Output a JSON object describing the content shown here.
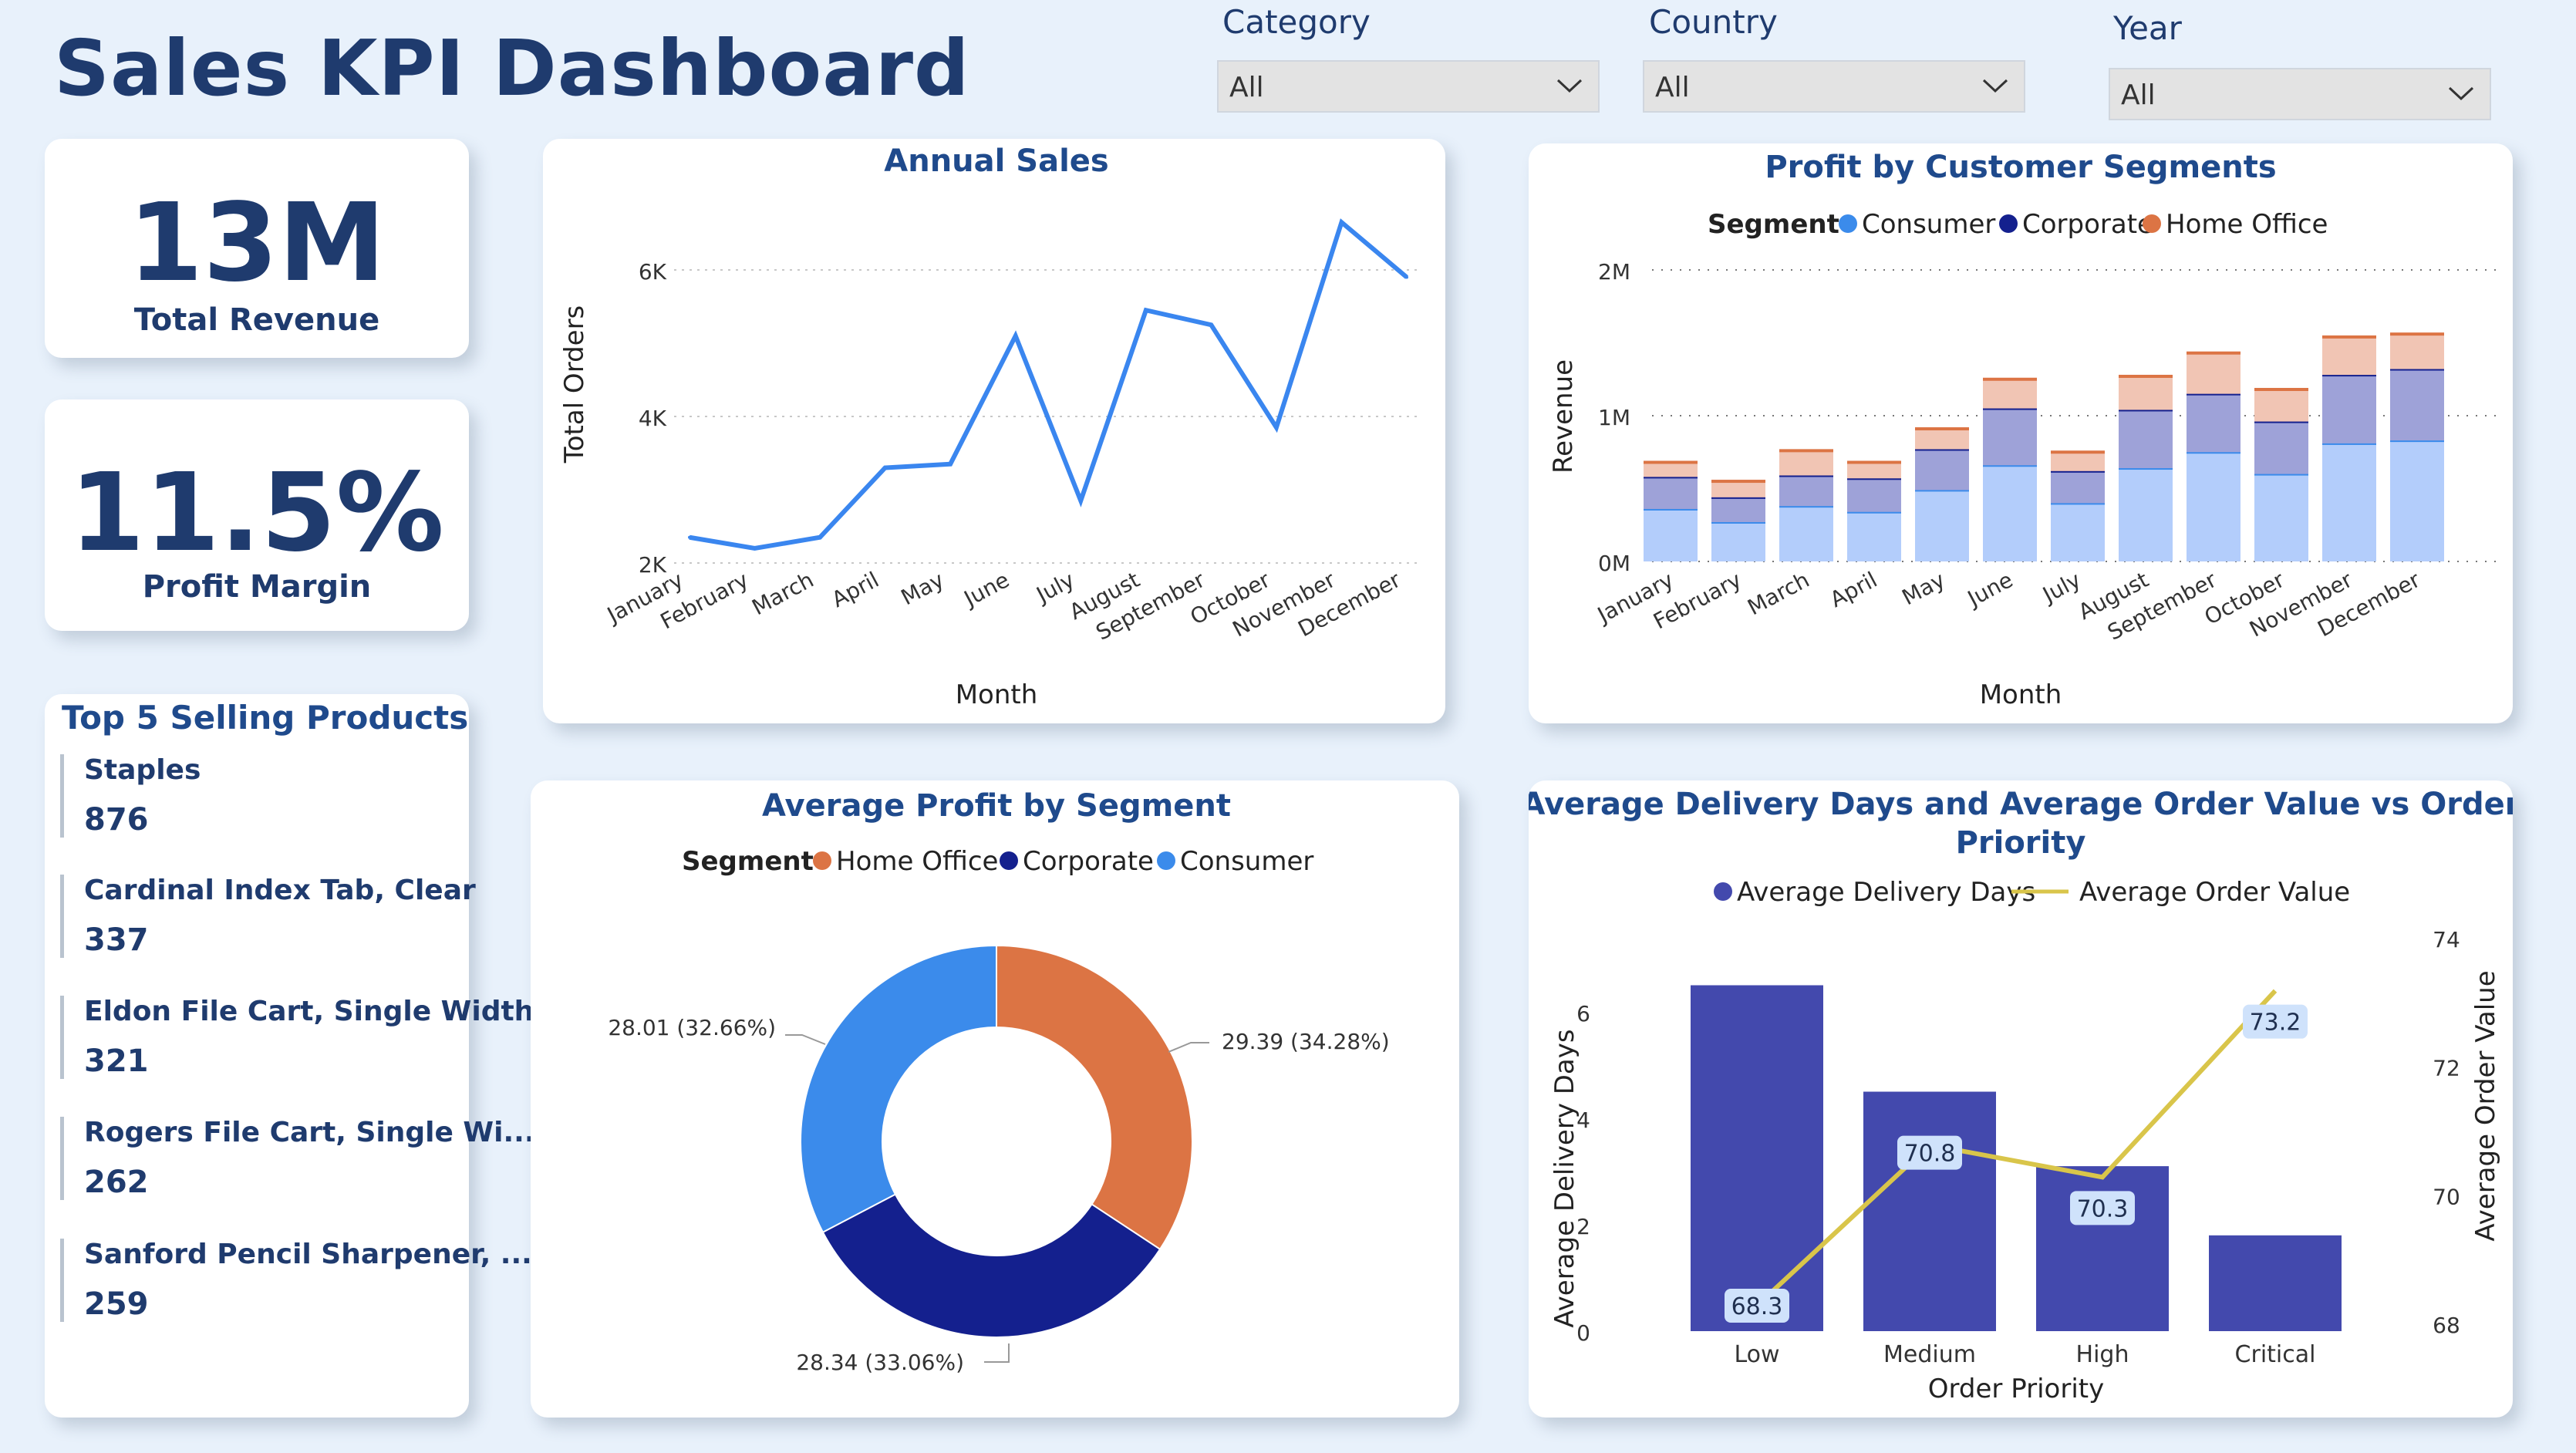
{
  "page_title": "Sales KPI Dashboard",
  "filters": [
    {
      "label": "Category",
      "value": "All"
    },
    {
      "label": "Country",
      "value": "All"
    },
    {
      "label": "Year",
      "value": "All"
    }
  ],
  "kpis": {
    "revenue": {
      "value": "13M",
      "label": "Total Revenue"
    },
    "margin": {
      "value": "11.5%",
      "label": "Profit Margin"
    }
  },
  "top_products": {
    "title": "Top 5 Selling Products",
    "items": [
      {
        "name": "Staples",
        "value": "876"
      },
      {
        "name": "Cardinal Index Tab, Clear",
        "value": "337"
      },
      {
        "name": "Eldon File Cart, Single Width",
        "value": "321"
      },
      {
        "name": "Rogers File Cart, Single Wi...",
        "value": "262"
      },
      {
        "name": "Sanford Pencil Sharpener, ...",
        "value": "259"
      }
    ]
  },
  "colors": {
    "line": "#3a86ef",
    "consumer": "#3b8beb",
    "corporate": "#14208e",
    "home_office": "#dc7444",
    "bar_purple": "#4349ad",
    "line_gold": "#d9c54a"
  },
  "chart_data": [
    {
      "id": "annual_sales",
      "type": "line",
      "title": "Annual Sales",
      "xlabel": "Month",
      "ylabel": "Total Orders",
      "categories": [
        "January",
        "February",
        "March",
        "April",
        "May",
        "June",
        "July",
        "August",
        "September",
        "October",
        "November",
        "December"
      ],
      "values": [
        2350,
        2200,
        2350,
        3300,
        3350,
        5100,
        2850,
        5450,
        5250,
        3850,
        6650,
        5900
      ],
      "y_ticks": [
        "2K",
        "4K",
        "6K"
      ],
      "ylim": [
        2000,
        6600
      ],
      "grid": true
    },
    {
      "id": "profit_segments",
      "type": "bar",
      "stacked": true,
      "title": "Profit by Customer Segments",
      "xlabel": "Month",
      "ylabel": "Revenue",
      "legend_title": "Segment",
      "legend": [
        "Consumer",
        "Corporate",
        "Home Office"
      ],
      "categories": [
        "January",
        "February",
        "March",
        "April",
        "May",
        "June",
        "July",
        "August",
        "September",
        "October",
        "November",
        "December"
      ],
      "series": [
        {
          "name": "Consumer",
          "values": [
            0.36,
            0.27,
            0.38,
            0.34,
            0.49,
            0.66,
            0.4,
            0.64,
            0.75,
            0.6,
            0.81,
            0.83
          ]
        },
        {
          "name": "Corporate",
          "values": [
            0.22,
            0.17,
            0.21,
            0.23,
            0.28,
            0.39,
            0.22,
            0.4,
            0.4,
            0.36,
            0.47,
            0.49
          ]
        },
        {
          "name": "Home Office",
          "values": [
            0.1,
            0.11,
            0.17,
            0.11,
            0.14,
            0.2,
            0.13,
            0.23,
            0.28,
            0.22,
            0.26,
            0.24
          ]
        }
      ],
      "y_ticks": [
        "0M",
        "1M",
        "2M"
      ],
      "ylim": [
        0,
        2
      ],
      "grid": true
    },
    {
      "id": "avg_profit_segment",
      "type": "pie",
      "donut": true,
      "title": "Average Profit by Segment",
      "legend_title": "Segment",
      "legend": [
        "Home Office",
        "Corporate",
        "Consumer"
      ],
      "slices": [
        {
          "name": "Home Office",
          "value": 29.39,
          "label": "29.39 (34.28%)"
        },
        {
          "name": "Corporate",
          "value": 28.34,
          "label": "28.34 (33.06%)"
        },
        {
          "name": "Consumer",
          "value": 28.01,
          "label": "28.01 (32.66%)"
        }
      ]
    },
    {
      "id": "delivery_vs_order_value",
      "type": "bar",
      "combo_line": true,
      "title_lines": [
        "Average Delivery Days and Average Order Value vs Order",
        "Priority"
      ],
      "xlabel": "Order Priority",
      "ylabel": "Average Delivery Days",
      "y2label": "Average Order Value",
      "legend": [
        "Average Delivery Days",
        "Average Order Value"
      ],
      "categories": [
        "Low",
        "Medium",
        "High",
        "Critical"
      ],
      "bar_values": [
        6.5,
        4.5,
        3.1,
        1.8
      ],
      "line_values": [
        68.3,
        70.8,
        70.3,
        73.2
      ],
      "line_labels": [
        "68.3",
        "70.8",
        "70.3",
        "73.2"
      ],
      "y_ticks": [
        "0",
        "2",
        "4",
        "6"
      ],
      "ylim": [
        0,
        7
      ],
      "y2_ticks": [
        "68",
        "70",
        "72",
        "74"
      ],
      "y2lim": [
        68,
        74
      ]
    }
  ]
}
